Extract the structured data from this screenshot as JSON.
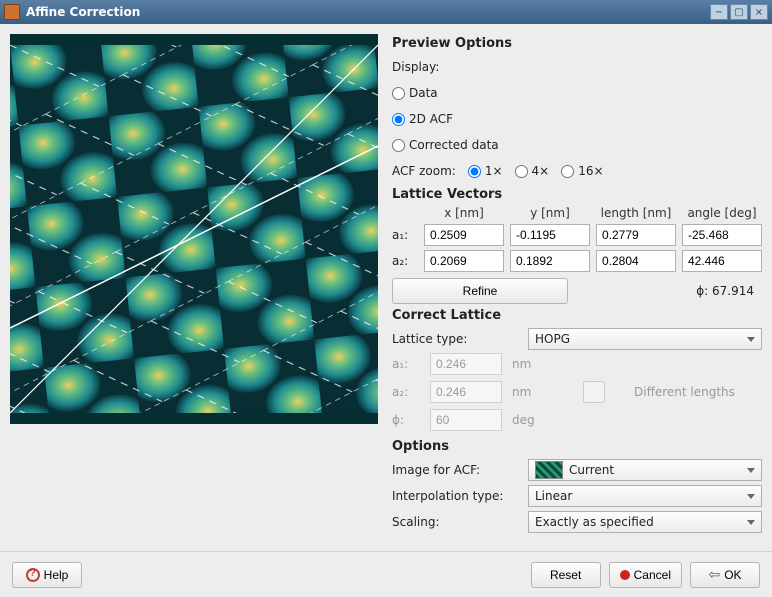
{
  "window": {
    "title": "Affine Correction"
  },
  "preview": {
    "section": "Preview Options",
    "display_label": "Display:",
    "radios": {
      "data": "Data",
      "acf": "2D ACF",
      "corrected": "Corrected data"
    },
    "zoom_label": "ACF zoom:",
    "zoom": {
      "z1": "1×",
      "z4": "4×",
      "z16": "16×"
    }
  },
  "lattice": {
    "section": "Lattice Vectors",
    "headers": {
      "x": "x [nm]",
      "y": "y [nm]",
      "len": "length [nm]",
      "ang": "angle [deg]"
    },
    "a1": {
      "label": "a₁:",
      "x": "0.2509",
      "y": "-0.1195",
      "len": "0.2779",
      "ang": "-25.468"
    },
    "a2": {
      "label": "a₂:",
      "x": "0.2069",
      "y": "0.1892",
      "len": "0.2804",
      "ang": "42.446"
    },
    "refine": "Refine",
    "phi": "ϕ: 67.914"
  },
  "correct": {
    "section": "Correct Lattice",
    "type_label": "Lattice type:",
    "type_value": "HOPG",
    "a1_label": "a₁:",
    "a1_val": "0.246",
    "a1_unit": "nm",
    "a2_label": "a₂:",
    "a2_val": "0.246",
    "a2_unit": "nm",
    "phi_label": "ϕ:",
    "phi_val": "60",
    "phi_unit": "deg",
    "diff_label": "Different lengths"
  },
  "options": {
    "section": "Options",
    "image_label": "Image for ACF:",
    "image_value": "Current",
    "interp_label": "Interpolation type:",
    "interp_value": "Linear",
    "scaling_label": "Scaling:",
    "scaling_value": "Exactly as specified"
  },
  "buttons": {
    "help": "Help",
    "reset": "Reset",
    "cancel": "Cancel",
    "ok": "OK"
  }
}
